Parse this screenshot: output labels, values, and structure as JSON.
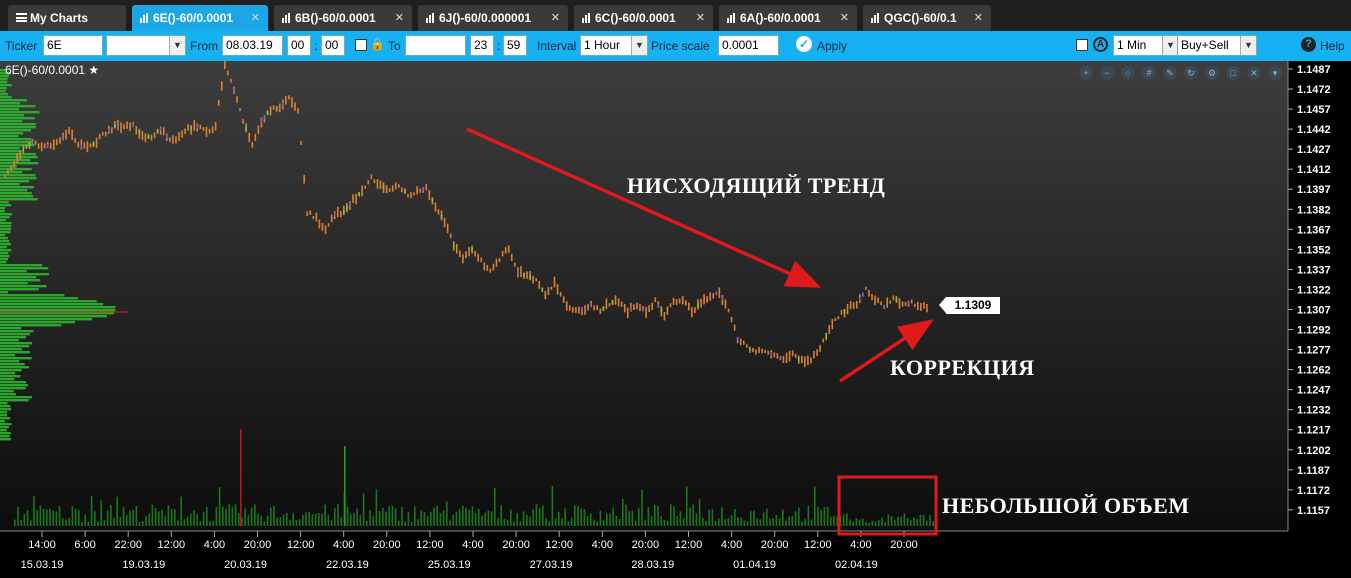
{
  "tabs": [
    {
      "label": "My Charts",
      "icon": "menu-icon",
      "active": false
    },
    {
      "label": "6E()-60/0.0001",
      "icon": "chart-bars-icon",
      "active": true
    },
    {
      "label": "6B()-60/0.0001",
      "icon": "chart-bars-icon",
      "active": false
    },
    {
      "label": "6J()-60/0.000001",
      "icon": "chart-bars-icon",
      "active": false
    },
    {
      "label": "6C()-60/0.0001",
      "icon": "chart-bars-icon",
      "active": false
    },
    {
      "label": "6A()-60/0.0001",
      "icon": "chart-bars-icon",
      "active": false
    },
    {
      "label": "QGC()-60/0.1",
      "icon": "chart-bars-icon",
      "active": false
    }
  ],
  "toolbar": {
    "ticker_label": "Ticker",
    "ticker_value": "6E",
    "from_label": "From",
    "from_date": "08.03.19",
    "from_hour": "00",
    "from_min": "00",
    "to_label": "To",
    "to_date": "",
    "to_hour": "23",
    "to_min": "59",
    "interval_label": "Interval",
    "interval_value": "1 Hour",
    "price_scale_label": "Price scale",
    "price_scale_value": "0.0001",
    "apply_label": "Apply",
    "timeframe_value": "1 Min",
    "side_value": "Buy+Sell",
    "help_label": "Help"
  },
  "chart": {
    "symbol": "6E()-60/0.0001",
    "last_price": "1.1309",
    "annotations": {
      "downtrend": "НИСХОДЯЩИЙ ТРЕНД",
      "correction": "КОРРЕКЦИЯ",
      "low_volume": "НЕБОЛЬШОЙ ОБЪЕМ"
    },
    "colors": {
      "tab_active": "#1ba6e6",
      "toolbar": "#16b1f2",
      "candles": "#e0812f",
      "volume": "#1f8a1f",
      "profile": "#2fb52f",
      "annotation_arrow": "#e0191c"
    }
  },
  "chart_data": {
    "type": "line",
    "y_ticks": [
      "1.1487",
      "1.1472",
      "1.1457",
      "1.1442",
      "1.1427",
      "1.1412",
      "1.1397",
      "1.1382",
      "1.1367",
      "1.1352",
      "1.1337",
      "1.1322",
      "1.1307",
      "1.1292",
      "1.1277",
      "1.1262",
      "1.1247",
      "1.1232",
      "1.1217",
      "1.1202",
      "1.1187",
      "1.1172",
      "1.1157"
    ],
    "ylim": [
      1.1148,
      1.1496
    ],
    "x_time_ticks": [
      "14:00",
      "6:00",
      "22:00",
      "12:00",
      "4:00",
      "20:00",
      "12:00",
      "4:00",
      "20:00",
      "12:00",
      "4:00",
      "20:00",
      "12:00",
      "4:00",
      "20:00",
      "12:00",
      "4:00",
      "20:00",
      "12:00",
      "4:00",
      "20:00"
    ],
    "x_date_ticks": [
      "15.03.19",
      "19.03.19",
      "20.03.19",
      "22.03.19",
      "25.03.19",
      "27.03.19",
      "28.03.19",
      "01.04.19",
      "02.04.19"
    ],
    "series": [
      {
        "values": [
          1.1408,
          1.1416,
          1.1427,
          1.1432,
          1.143,
          1.1429,
          1.1433,
          1.1441,
          1.143,
          1.1428,
          1.1433,
          1.1439,
          1.1444,
          1.1443,
          1.1445,
          1.1437,
          1.1436,
          1.1442,
          1.1434,
          1.1435,
          1.1442,
          1.1444,
          1.1439,
          1.1445,
          1.1491,
          1.1471,
          1.1449,
          1.143,
          1.1448,
          1.1457,
          1.1458,
          1.1466,
          1.1457,
          1.138,
          1.1375,
          1.1367,
          1.1378,
          1.138,
          1.1389,
          1.1395,
          1.1405,
          1.14,
          1.1397,
          1.1399,
          1.1393,
          1.1396,
          1.1398,
          1.1385,
          1.1372,
          1.1355,
          1.1345,
          1.1352,
          1.1343,
          1.1335,
          1.1345,
          1.1353,
          1.1335,
          1.1332,
          1.133,
          1.1318,
          1.1327,
          1.1313,
          1.1306,
          1.1307,
          1.131,
          1.1306,
          1.1312,
          1.1313,
          1.1306,
          1.1311,
          1.1305,
          1.1313,
          1.1303,
          1.1312,
          1.1315,
          1.1306,
          1.1312,
          1.1317,
          1.132,
          1.1306,
          1.1285,
          1.1279,
          1.1275,
          1.1277,
          1.1272,
          1.127,
          1.1274,
          1.1268,
          1.1269,
          1.1277,
          1.1293,
          1.1301,
          1.1308,
          1.1311,
          1.1322,
          1.1315,
          1.1309,
          1.1316,
          1.1311,
          1.1312,
          1.131,
          1.1309
        ]
      }
    ]
  }
}
